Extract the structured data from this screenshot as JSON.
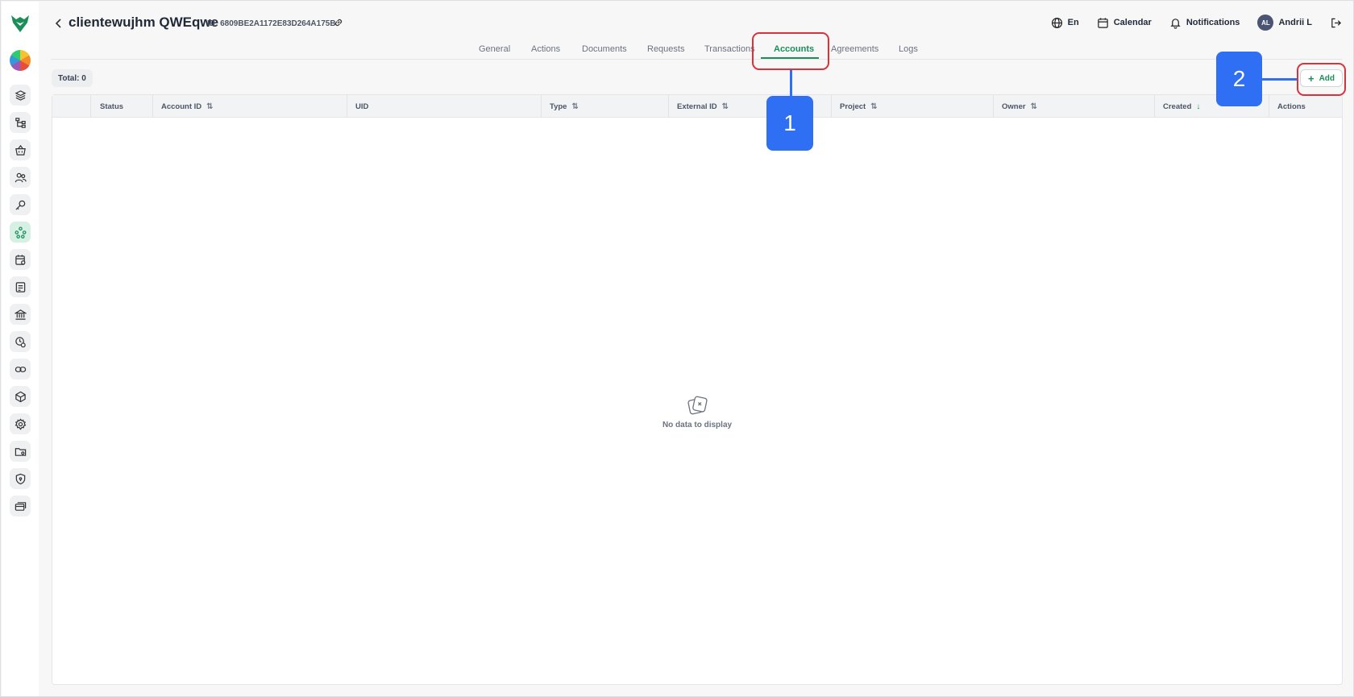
{
  "header": {
    "title": "clientewujhm QWEqwe",
    "id_text": "ID: 6809BE2A1172E83D264A175B"
  },
  "top_actions": {
    "language": "En",
    "calendar": "Calendar",
    "notifications": "Notifications",
    "avatar_initials": "AL",
    "user_name": "Andrii L"
  },
  "tabs": [
    "General",
    "Actions",
    "Documents",
    "Requests",
    "Transactions",
    "Accounts",
    "Agreements",
    "Logs"
  ],
  "active_tab": "Accounts",
  "toolbar": {
    "total": "Total: 0",
    "add_label": "Add"
  },
  "table": {
    "columns": [
      "Status",
      "Account ID",
      "UID",
      "Type",
      "External ID",
      "Project",
      "Owner",
      "Created",
      "Actions"
    ],
    "empty_text": "No data to display"
  },
  "annotations": {
    "callout_1": "1",
    "callout_2": "2"
  },
  "colors": {
    "accent": "#1b8e5a",
    "callout": "#2f6ff4",
    "highlight": "#d9323b"
  }
}
